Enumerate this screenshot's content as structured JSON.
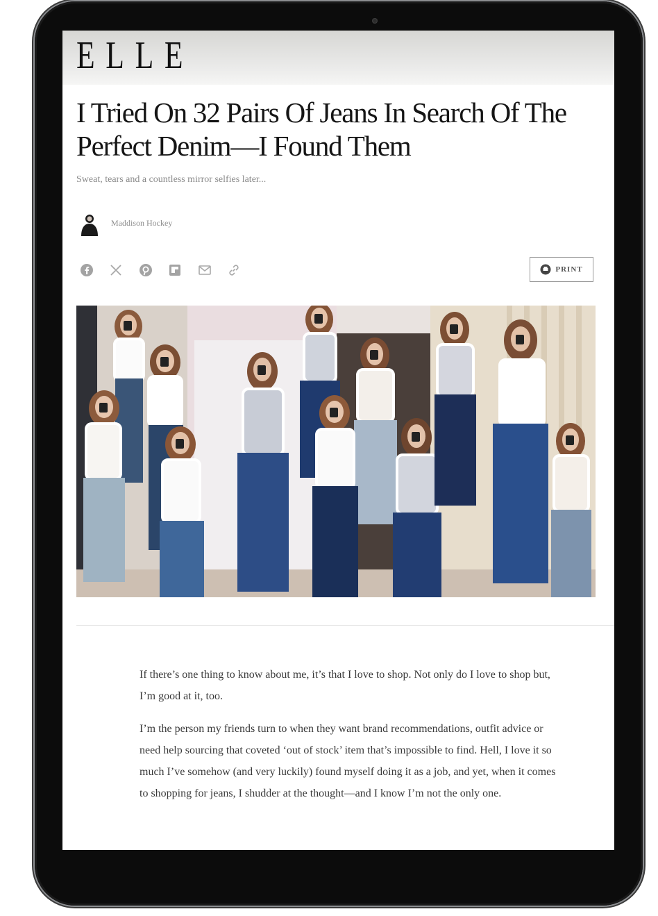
{
  "site": {
    "logo": "ELLE"
  },
  "article": {
    "headline": "I Tried On 32 Pairs Of Jeans In Search Of The Perfect Denim—I Found Them",
    "dek": "Sweat, tears and a countless mirror selfies later...",
    "author": "Maddison Hockey",
    "paragraphs": [
      "If there’s one thing to know about me, it’s that I love to shop. Not only do I love to shop but, I’m good at it, too.",
      "I’m the person my friends turn to when they want brand recommendations, outfit advice or need help sourcing that coveted ‘out of stock’ item that’s impossible to find. Hell, I love it so much I’ve somehow (and very luckily) found myself doing it as a job, and yet, when it comes to shopping for jeans, I shudder at the thought—and I know I’m not the only one."
    ]
  },
  "share": {
    "icons": [
      "facebook-icon",
      "x-icon",
      "pinterest-icon",
      "flipboard-icon",
      "email-icon",
      "link-icon"
    ],
    "print_label": "PRINT"
  },
  "hero": {
    "image": "collage of mirror selfies in jeans"
  },
  "colors": {
    "headline": "#151515",
    "muted": "#8a8a8a",
    "body": "#3a3a3a",
    "bezel": "#0c0c0c"
  }
}
